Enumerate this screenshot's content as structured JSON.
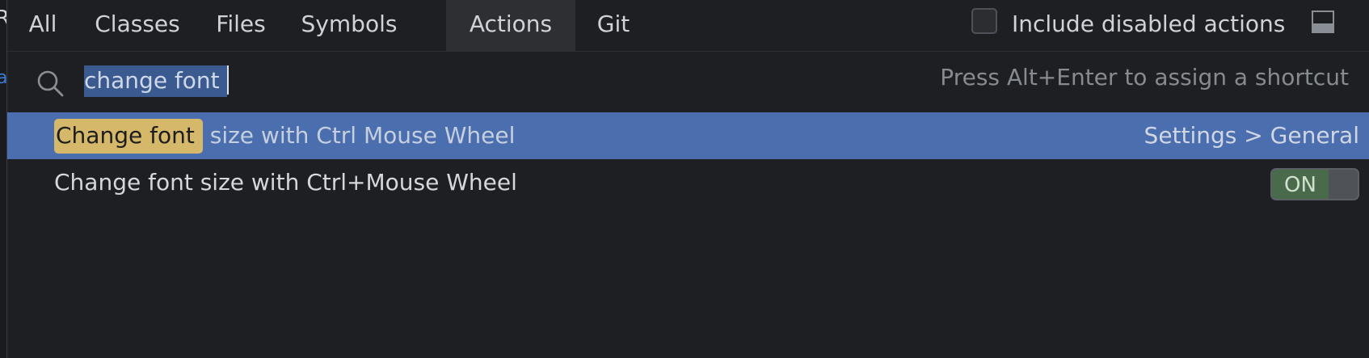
{
  "background_edge": {
    "char_top": "R",
    "char_mid": "a"
  },
  "tabs": [
    {
      "label": "All",
      "active": false
    },
    {
      "label": "Classes",
      "active": false
    },
    {
      "label": "Files",
      "active": false
    },
    {
      "label": "Symbols",
      "active": false
    },
    {
      "label": "Actions",
      "active": true
    },
    {
      "label": "Git",
      "active": false
    }
  ],
  "include_disabled": {
    "label": "Include disabled actions",
    "checked": false
  },
  "search": {
    "value": "change font ",
    "hint": "Press Alt+Enter to assign a shortcut"
  },
  "results": [
    {
      "match": "Change font",
      "rest": " size with Ctrl Mouse Wheel",
      "right": "Settings > General",
      "selected": true
    },
    {
      "text": "Change font size with Ctrl+Mouse Wheel",
      "toggle": "ON",
      "selected": false
    }
  ],
  "colors": {
    "background": "#1e1f22",
    "active_tab": "#2d2f33",
    "selection": "#4b6eaf",
    "match_highlight": "#d5b869",
    "toggle_on": "#4a6b4b"
  },
  "icons": {
    "search": "search-icon",
    "layout": "layout-toggle-icon"
  }
}
